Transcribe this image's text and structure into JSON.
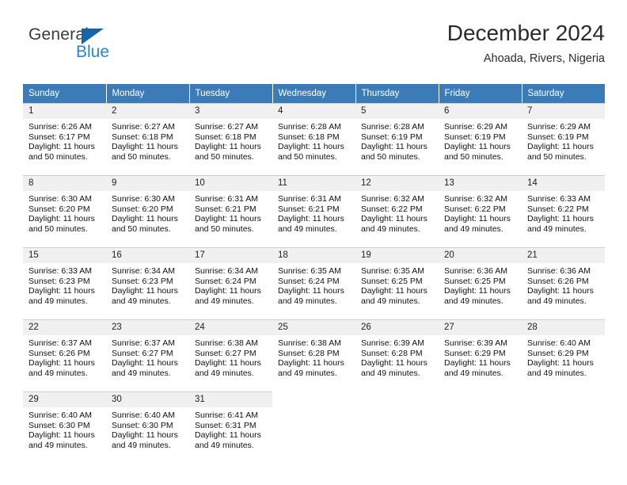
{
  "brand": {
    "name_top": "General",
    "name_bottom": "Blue",
    "triangle_color": "#1565a8",
    "blue_color": "#2a86d0"
  },
  "header": {
    "title": "December 2024",
    "location": "Ahoada, Rivers, Nigeria"
  },
  "theme": {
    "header_row_bg": "#3b7cb8",
    "daynum_bg": "#f0f0f0",
    "grid_line": "#cfcfcf"
  },
  "weekdays": [
    "Sunday",
    "Monday",
    "Tuesday",
    "Wednesday",
    "Thursday",
    "Friday",
    "Saturday"
  ],
  "weeks": [
    [
      {
        "day": "1",
        "sunrise": "Sunrise: 6:26 AM",
        "sunset": "Sunset: 6:17 PM",
        "daylight1": "Daylight: 11 hours",
        "daylight2": "and 50 minutes."
      },
      {
        "day": "2",
        "sunrise": "Sunrise: 6:27 AM",
        "sunset": "Sunset: 6:18 PM",
        "daylight1": "Daylight: 11 hours",
        "daylight2": "and 50 minutes."
      },
      {
        "day": "3",
        "sunrise": "Sunrise: 6:27 AM",
        "sunset": "Sunset: 6:18 PM",
        "daylight1": "Daylight: 11 hours",
        "daylight2": "and 50 minutes."
      },
      {
        "day": "4",
        "sunrise": "Sunrise: 6:28 AM",
        "sunset": "Sunset: 6:18 PM",
        "daylight1": "Daylight: 11 hours",
        "daylight2": "and 50 minutes."
      },
      {
        "day": "5",
        "sunrise": "Sunrise: 6:28 AM",
        "sunset": "Sunset: 6:19 PM",
        "daylight1": "Daylight: 11 hours",
        "daylight2": "and 50 minutes."
      },
      {
        "day": "6",
        "sunrise": "Sunrise: 6:29 AM",
        "sunset": "Sunset: 6:19 PM",
        "daylight1": "Daylight: 11 hours",
        "daylight2": "and 50 minutes."
      },
      {
        "day": "7",
        "sunrise": "Sunrise: 6:29 AM",
        "sunset": "Sunset: 6:19 PM",
        "daylight1": "Daylight: 11 hours",
        "daylight2": "and 50 minutes."
      }
    ],
    [
      {
        "day": "8",
        "sunrise": "Sunrise: 6:30 AM",
        "sunset": "Sunset: 6:20 PM",
        "daylight1": "Daylight: 11 hours",
        "daylight2": "and 50 minutes."
      },
      {
        "day": "9",
        "sunrise": "Sunrise: 6:30 AM",
        "sunset": "Sunset: 6:20 PM",
        "daylight1": "Daylight: 11 hours",
        "daylight2": "and 50 minutes."
      },
      {
        "day": "10",
        "sunrise": "Sunrise: 6:31 AM",
        "sunset": "Sunset: 6:21 PM",
        "daylight1": "Daylight: 11 hours",
        "daylight2": "and 50 minutes."
      },
      {
        "day": "11",
        "sunrise": "Sunrise: 6:31 AM",
        "sunset": "Sunset: 6:21 PM",
        "daylight1": "Daylight: 11 hours",
        "daylight2": "and 49 minutes."
      },
      {
        "day": "12",
        "sunrise": "Sunrise: 6:32 AM",
        "sunset": "Sunset: 6:22 PM",
        "daylight1": "Daylight: 11 hours",
        "daylight2": "and 49 minutes."
      },
      {
        "day": "13",
        "sunrise": "Sunrise: 6:32 AM",
        "sunset": "Sunset: 6:22 PM",
        "daylight1": "Daylight: 11 hours",
        "daylight2": "and 49 minutes."
      },
      {
        "day": "14",
        "sunrise": "Sunrise: 6:33 AM",
        "sunset": "Sunset: 6:22 PM",
        "daylight1": "Daylight: 11 hours",
        "daylight2": "and 49 minutes."
      }
    ],
    [
      {
        "day": "15",
        "sunrise": "Sunrise: 6:33 AM",
        "sunset": "Sunset: 6:23 PM",
        "daylight1": "Daylight: 11 hours",
        "daylight2": "and 49 minutes."
      },
      {
        "day": "16",
        "sunrise": "Sunrise: 6:34 AM",
        "sunset": "Sunset: 6:23 PM",
        "daylight1": "Daylight: 11 hours",
        "daylight2": "and 49 minutes."
      },
      {
        "day": "17",
        "sunrise": "Sunrise: 6:34 AM",
        "sunset": "Sunset: 6:24 PM",
        "daylight1": "Daylight: 11 hours",
        "daylight2": "and 49 minutes."
      },
      {
        "day": "18",
        "sunrise": "Sunrise: 6:35 AM",
        "sunset": "Sunset: 6:24 PM",
        "daylight1": "Daylight: 11 hours",
        "daylight2": "and 49 minutes."
      },
      {
        "day": "19",
        "sunrise": "Sunrise: 6:35 AM",
        "sunset": "Sunset: 6:25 PM",
        "daylight1": "Daylight: 11 hours",
        "daylight2": "and 49 minutes."
      },
      {
        "day": "20",
        "sunrise": "Sunrise: 6:36 AM",
        "sunset": "Sunset: 6:25 PM",
        "daylight1": "Daylight: 11 hours",
        "daylight2": "and 49 minutes."
      },
      {
        "day": "21",
        "sunrise": "Sunrise: 6:36 AM",
        "sunset": "Sunset: 6:26 PM",
        "daylight1": "Daylight: 11 hours",
        "daylight2": "and 49 minutes."
      }
    ],
    [
      {
        "day": "22",
        "sunrise": "Sunrise: 6:37 AM",
        "sunset": "Sunset: 6:26 PM",
        "daylight1": "Daylight: 11 hours",
        "daylight2": "and 49 minutes."
      },
      {
        "day": "23",
        "sunrise": "Sunrise: 6:37 AM",
        "sunset": "Sunset: 6:27 PM",
        "daylight1": "Daylight: 11 hours",
        "daylight2": "and 49 minutes."
      },
      {
        "day": "24",
        "sunrise": "Sunrise: 6:38 AM",
        "sunset": "Sunset: 6:27 PM",
        "daylight1": "Daylight: 11 hours",
        "daylight2": "and 49 minutes."
      },
      {
        "day": "25",
        "sunrise": "Sunrise: 6:38 AM",
        "sunset": "Sunset: 6:28 PM",
        "daylight1": "Daylight: 11 hours",
        "daylight2": "and 49 minutes."
      },
      {
        "day": "26",
        "sunrise": "Sunrise: 6:39 AM",
        "sunset": "Sunset: 6:28 PM",
        "daylight1": "Daylight: 11 hours",
        "daylight2": "and 49 minutes."
      },
      {
        "day": "27",
        "sunrise": "Sunrise: 6:39 AM",
        "sunset": "Sunset: 6:29 PM",
        "daylight1": "Daylight: 11 hours",
        "daylight2": "and 49 minutes."
      },
      {
        "day": "28",
        "sunrise": "Sunrise: 6:40 AM",
        "sunset": "Sunset: 6:29 PM",
        "daylight1": "Daylight: 11 hours",
        "daylight2": "and 49 minutes."
      }
    ],
    [
      {
        "day": "29",
        "sunrise": "Sunrise: 6:40 AM",
        "sunset": "Sunset: 6:30 PM",
        "daylight1": "Daylight: 11 hours",
        "daylight2": "and 49 minutes."
      },
      {
        "day": "30",
        "sunrise": "Sunrise: 6:40 AM",
        "sunset": "Sunset: 6:30 PM",
        "daylight1": "Daylight: 11 hours",
        "daylight2": "and 49 minutes."
      },
      {
        "day": "31",
        "sunrise": "Sunrise: 6:41 AM",
        "sunset": "Sunset: 6:31 PM",
        "daylight1": "Daylight: 11 hours",
        "daylight2": "and 49 minutes."
      },
      null,
      null,
      null,
      null
    ]
  ]
}
